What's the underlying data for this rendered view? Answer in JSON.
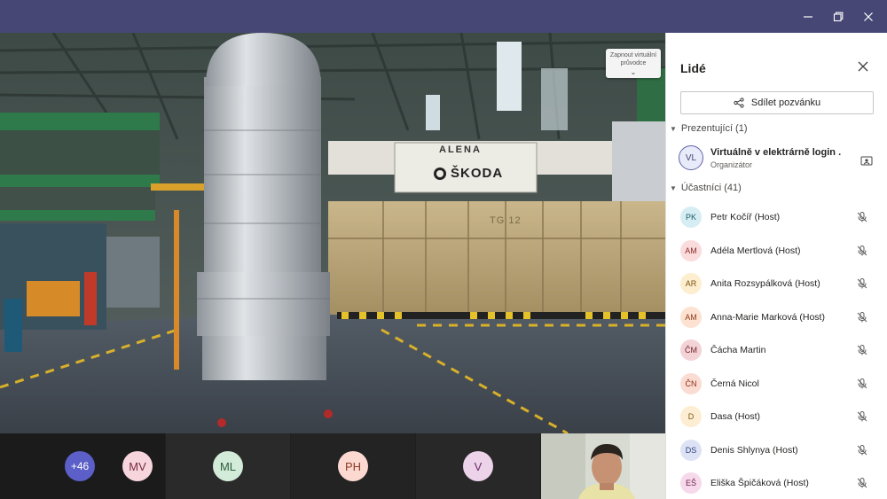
{
  "window": {
    "controls": [
      "minimize-icon",
      "restore-icon",
      "close-icon"
    ]
  },
  "stage": {
    "tooltip": "Zapnout virtuální průvodce",
    "signs": {
      "alena": "ALENA",
      "brand": "ŠKODA",
      "unit": "TG 12"
    }
  },
  "strip": {
    "overflow_count": "+46",
    "avatars": [
      {
        "initials": "MV",
        "bg": "#f6d5dd",
        "fg": "#7a2a41"
      },
      {
        "initials": "ML",
        "bg": "#d2ecd9",
        "fg": "#2c5d3a"
      },
      {
        "initials": "PH",
        "bg": "#fbd9d0",
        "fg": "#8a3a24"
      },
      {
        "initials": "V",
        "bg": "#ecd3ea",
        "fg": "#6e2a66"
      }
    ]
  },
  "panel": {
    "title": "Lidé",
    "invite_label": "Sdílet pozvánku",
    "presenters_heading": "Prezentující (1)",
    "presenter": {
      "initials": "VL",
      "name": "Virtuálně v elektrárně login .",
      "role": "Organizátor"
    },
    "participants_heading": "Účastníci (41)",
    "participants": [
      {
        "initials": "PK",
        "name": "Petr Kočíř (Host)",
        "bg": "#d6eef3",
        "fg": "#1e5c69"
      },
      {
        "initials": "AM",
        "name": "Adéla Mertlová (Host)",
        "bg": "#fbdcdc",
        "fg": "#8b2a2a"
      },
      {
        "initials": "AR",
        "name": "Anita Rozsypálková (Host)",
        "bg": "#fdeecf",
        "fg": "#7a5210"
      },
      {
        "initials": "AM",
        "name": "Anna-Marie Marková (Host)",
        "bg": "#fde2d2",
        "fg": "#8b3a16"
      },
      {
        "initials": "ČM",
        "name": "Čácha Martin",
        "bg": "#f3d3d6",
        "fg": "#6e1e2a"
      },
      {
        "initials": "ČN",
        "name": "Černá Nicol",
        "bg": "#fbdcd2",
        "fg": "#8b2e1a"
      },
      {
        "initials": "D",
        "name": "Dasa (Host)",
        "bg": "#fdeed3",
        "fg": "#7a5410"
      },
      {
        "initials": "DS",
        "name": "Denis Shlynya (Host)",
        "bg": "#dde3f5",
        "fg": "#2d3f7a"
      },
      {
        "initials": "EŠ",
        "name": "Eliška Špičáková (Host)",
        "bg": "#f6d9ea",
        "fg": "#6e1f52"
      }
    ]
  }
}
